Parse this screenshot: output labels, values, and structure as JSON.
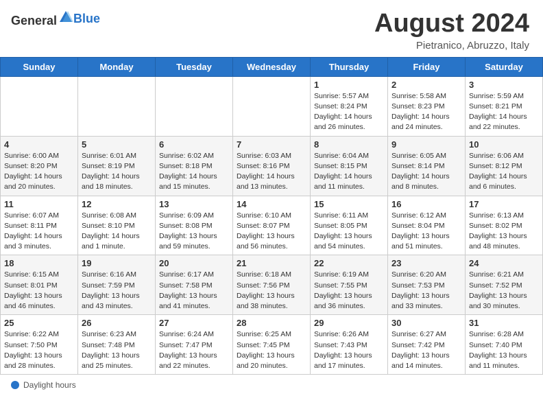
{
  "header": {
    "logo_general": "General",
    "logo_blue": "Blue",
    "month_title": "August 2024",
    "location": "Pietranico, Abruzzo, Italy"
  },
  "footer": {
    "daylight_label": "Daylight hours"
  },
  "days_of_week": [
    "Sunday",
    "Monday",
    "Tuesday",
    "Wednesday",
    "Thursday",
    "Friday",
    "Saturday"
  ],
  "weeks": [
    [
      {
        "day": "",
        "info": ""
      },
      {
        "day": "",
        "info": ""
      },
      {
        "day": "",
        "info": ""
      },
      {
        "day": "",
        "info": ""
      },
      {
        "day": "1",
        "info": "Sunrise: 5:57 AM\nSunset: 8:24 PM\nDaylight: 14 hours and 26 minutes."
      },
      {
        "day": "2",
        "info": "Sunrise: 5:58 AM\nSunset: 8:23 PM\nDaylight: 14 hours and 24 minutes."
      },
      {
        "day": "3",
        "info": "Sunrise: 5:59 AM\nSunset: 8:21 PM\nDaylight: 14 hours and 22 minutes."
      }
    ],
    [
      {
        "day": "4",
        "info": "Sunrise: 6:00 AM\nSunset: 8:20 PM\nDaylight: 14 hours and 20 minutes."
      },
      {
        "day": "5",
        "info": "Sunrise: 6:01 AM\nSunset: 8:19 PM\nDaylight: 14 hours and 18 minutes."
      },
      {
        "day": "6",
        "info": "Sunrise: 6:02 AM\nSunset: 8:18 PM\nDaylight: 14 hours and 15 minutes."
      },
      {
        "day": "7",
        "info": "Sunrise: 6:03 AM\nSunset: 8:16 PM\nDaylight: 14 hours and 13 minutes."
      },
      {
        "day": "8",
        "info": "Sunrise: 6:04 AM\nSunset: 8:15 PM\nDaylight: 14 hours and 11 minutes."
      },
      {
        "day": "9",
        "info": "Sunrise: 6:05 AM\nSunset: 8:14 PM\nDaylight: 14 hours and 8 minutes."
      },
      {
        "day": "10",
        "info": "Sunrise: 6:06 AM\nSunset: 8:12 PM\nDaylight: 14 hours and 6 minutes."
      }
    ],
    [
      {
        "day": "11",
        "info": "Sunrise: 6:07 AM\nSunset: 8:11 PM\nDaylight: 14 hours and 3 minutes."
      },
      {
        "day": "12",
        "info": "Sunrise: 6:08 AM\nSunset: 8:10 PM\nDaylight: 14 hours and 1 minute."
      },
      {
        "day": "13",
        "info": "Sunrise: 6:09 AM\nSunset: 8:08 PM\nDaylight: 13 hours and 59 minutes."
      },
      {
        "day": "14",
        "info": "Sunrise: 6:10 AM\nSunset: 8:07 PM\nDaylight: 13 hours and 56 minutes."
      },
      {
        "day": "15",
        "info": "Sunrise: 6:11 AM\nSunset: 8:05 PM\nDaylight: 13 hours and 54 minutes."
      },
      {
        "day": "16",
        "info": "Sunrise: 6:12 AM\nSunset: 8:04 PM\nDaylight: 13 hours and 51 minutes."
      },
      {
        "day": "17",
        "info": "Sunrise: 6:13 AM\nSunset: 8:02 PM\nDaylight: 13 hours and 48 minutes."
      }
    ],
    [
      {
        "day": "18",
        "info": "Sunrise: 6:15 AM\nSunset: 8:01 PM\nDaylight: 13 hours and 46 minutes."
      },
      {
        "day": "19",
        "info": "Sunrise: 6:16 AM\nSunset: 7:59 PM\nDaylight: 13 hours and 43 minutes."
      },
      {
        "day": "20",
        "info": "Sunrise: 6:17 AM\nSunset: 7:58 PM\nDaylight: 13 hours and 41 minutes."
      },
      {
        "day": "21",
        "info": "Sunrise: 6:18 AM\nSunset: 7:56 PM\nDaylight: 13 hours and 38 minutes."
      },
      {
        "day": "22",
        "info": "Sunrise: 6:19 AM\nSunset: 7:55 PM\nDaylight: 13 hours and 36 minutes."
      },
      {
        "day": "23",
        "info": "Sunrise: 6:20 AM\nSunset: 7:53 PM\nDaylight: 13 hours and 33 minutes."
      },
      {
        "day": "24",
        "info": "Sunrise: 6:21 AM\nSunset: 7:52 PM\nDaylight: 13 hours and 30 minutes."
      }
    ],
    [
      {
        "day": "25",
        "info": "Sunrise: 6:22 AM\nSunset: 7:50 PM\nDaylight: 13 hours and 28 minutes."
      },
      {
        "day": "26",
        "info": "Sunrise: 6:23 AM\nSunset: 7:48 PM\nDaylight: 13 hours and 25 minutes."
      },
      {
        "day": "27",
        "info": "Sunrise: 6:24 AM\nSunset: 7:47 PM\nDaylight: 13 hours and 22 minutes."
      },
      {
        "day": "28",
        "info": "Sunrise: 6:25 AM\nSunset: 7:45 PM\nDaylight: 13 hours and 20 minutes."
      },
      {
        "day": "29",
        "info": "Sunrise: 6:26 AM\nSunset: 7:43 PM\nDaylight: 13 hours and 17 minutes."
      },
      {
        "day": "30",
        "info": "Sunrise: 6:27 AM\nSunset: 7:42 PM\nDaylight: 13 hours and 14 minutes."
      },
      {
        "day": "31",
        "info": "Sunrise: 6:28 AM\nSunset: 7:40 PM\nDaylight: 13 hours and 11 minutes."
      }
    ]
  ]
}
